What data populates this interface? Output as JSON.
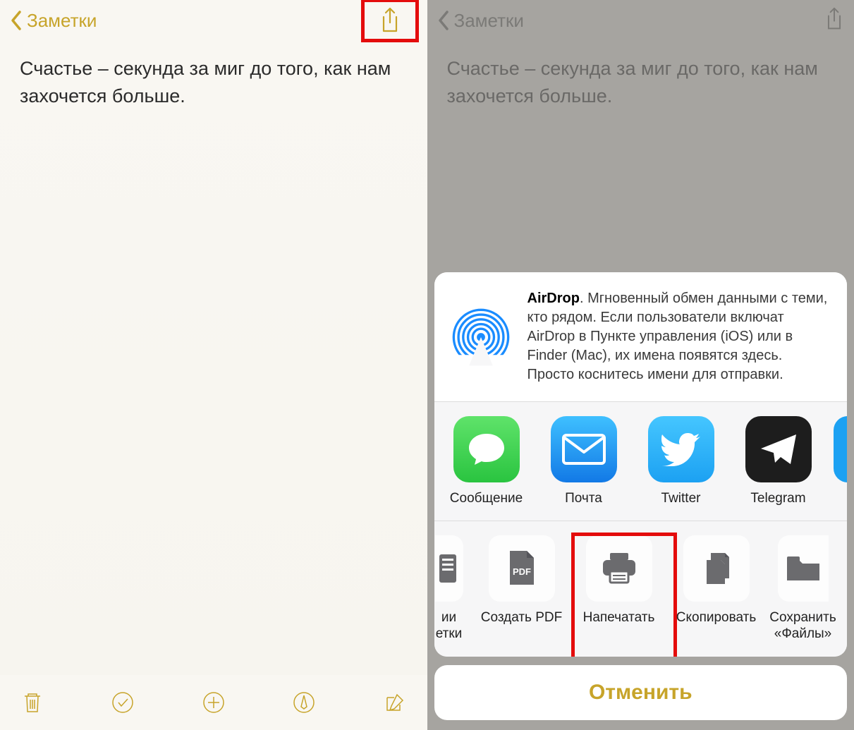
{
  "left": {
    "back_label": "Заметки",
    "note_text": "Счастье – секунда за миг до того, как нам захочется больше."
  },
  "right": {
    "back_label": "Заметки",
    "note_text": "Счастье – секунда за миг до того, как нам захочется больше.",
    "airdrop_title": "AirDrop",
    "airdrop_desc": ". Мгновенный обмен данными с теми, кто рядом. Если пользователи включат AirDrop в Пункте управления (iOS) или в Finder (Mac), их имена появятся здесь. Просто коснитесь имени для отправки.",
    "apps": [
      {
        "label": "Сообщение"
      },
      {
        "label": "Почта"
      },
      {
        "label": "Twitter"
      },
      {
        "label": "Telegram"
      }
    ],
    "actions": [
      {
        "label_a": "ии",
        "label_b": "етки"
      },
      {
        "label": "Создать PDF"
      },
      {
        "label": "Напечатать"
      },
      {
        "label": "Скопировать"
      },
      {
        "label_a": "Сохранить",
        "label_b": "«Файлы»"
      }
    ],
    "cancel_label": "Отменить",
    "pdf_badge": "PDF"
  }
}
